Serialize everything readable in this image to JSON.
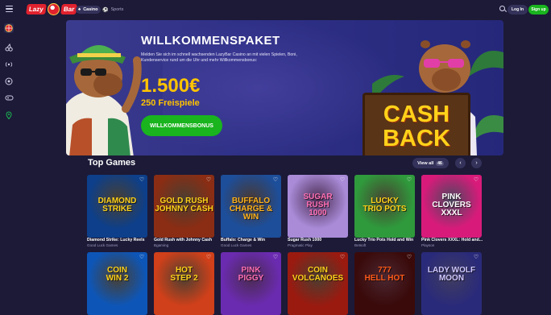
{
  "header": {
    "logo_text_1": "Lazy",
    "logo_text_2": "Bar",
    "tabs": [
      {
        "label": "Casino",
        "icon": "spade-icon",
        "active": true
      },
      {
        "label": "Sports",
        "icon": "ball-icon",
        "active": false
      }
    ],
    "login_label": "Log In",
    "signup_label": "Sign up"
  },
  "sidebar": {
    "items": [
      {
        "icon": "wheel-icon"
      },
      {
        "icon": "cherries-icon"
      },
      {
        "icon": "live-icon"
      },
      {
        "icon": "football-icon"
      },
      {
        "icon": "gamepad-icon"
      },
      {
        "icon": "location-pin-icon"
      }
    ]
  },
  "hero": {
    "title": "WILLKOMMENSPAKET",
    "description": "Melden Sie sich im schnell wachsenden LazyBar Casino an mit vielen Spielen, Boni, Kundenservice rund um die Uhr und mehr Willkommensbonus:",
    "amount": "1.500€",
    "spins": "250 Freispiele",
    "cta": "WILLKOMMENSBONUS",
    "sign_line_1": "CASH",
    "sign_line_2": "BACK"
  },
  "top_games": {
    "title": "Top Games",
    "view_all_label": "View all",
    "view_all_count": "46",
    "games": [
      {
        "art_lines": [
          "DIAMOND",
          "STRIKE"
        ],
        "name": "Diamond Strike: Lucky Reels",
        "provider": "Good Luck Games",
        "bg": "#0d3f8a",
        "accent": "#ffd21a"
      },
      {
        "art_lines": [
          "GOLD RUSH",
          "JOHNNY CASH"
        ],
        "name": "Gold Rush with Johnny Cash",
        "provider": "Bgaming",
        "bg": "#8a2d14",
        "accent": "#ffd21a"
      },
      {
        "art_lines": [
          "BUFFALO",
          "CHARGE & WIN"
        ],
        "name": "Buffalo: Charge & Win",
        "provider": "Good Luck Games",
        "bg": "#1d4e9a",
        "accent": "#ffb21a"
      },
      {
        "art_lines": [
          "SUGAR",
          "RUSH",
          "1000"
        ],
        "name": "Sugar Rush 1000",
        "provider": "Pragmatic Play",
        "bg": "#a98bd8",
        "accent": "#ff6fb3"
      },
      {
        "art_lines": [
          "LUCKY",
          "TRIO POTS"
        ],
        "name": "Lucky Trio Pots Hold and Win",
        "provider": "Betsoft",
        "bg": "#2f9a3c",
        "accent": "#ffd21a"
      },
      {
        "art_lines": [
          "PINK",
          "CLOVERS",
          "XXXL"
        ],
        "name": "Pink Clovers XXXL: Hold and...",
        "provider": "Playson",
        "bg": "#d81b7a",
        "accent": "#ffffff"
      }
    ],
    "games_row2": [
      {
        "art_lines": [
          "COIN",
          "WIN 2"
        ],
        "bg": "#0d56b8",
        "accent": "#ffd21a"
      },
      {
        "art_lines": [
          "HOT",
          "STEP 2"
        ],
        "bg": "#d0401a",
        "accent": "#ffd21a"
      },
      {
        "art_lines": [
          "PINK",
          "PIGGY"
        ],
        "bg": "#6b2bb0",
        "accent": "#ff6fb3"
      },
      {
        "art_lines": [
          "COIN",
          "VOLCANOES"
        ],
        "bg": "#9a1a10",
        "accent": "#ffd21a"
      },
      {
        "art_lines": [
          "777",
          "HELL HOT"
        ],
        "bg": "#3a0a0a",
        "accent": "#ff5a1a"
      },
      {
        "art_lines": [
          "LADY WOLF",
          "MOON"
        ],
        "bg": "#2a2a7a",
        "accent": "#d0c8ff"
      }
    ]
  }
}
